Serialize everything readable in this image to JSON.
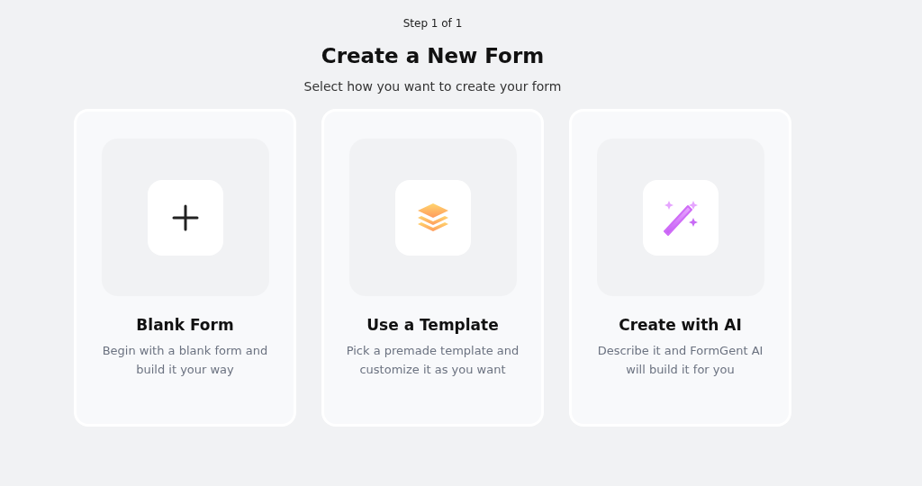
{
  "step": "Step 1 of 1",
  "title": "Create a New Form",
  "subtitle": "Select how you want to create your form",
  "options": [
    {
      "kind": "plus",
      "title": "Blank Form",
      "description": "Begin with a blank form and build it your way"
    },
    {
      "kind": "layers",
      "title": "Use a Template",
      "description": "Pick a premade template and customize it as you want"
    },
    {
      "kind": "wand",
      "title": "Create with AI",
      "description": "Describe it and FormGent AI will build it for you"
    }
  ]
}
